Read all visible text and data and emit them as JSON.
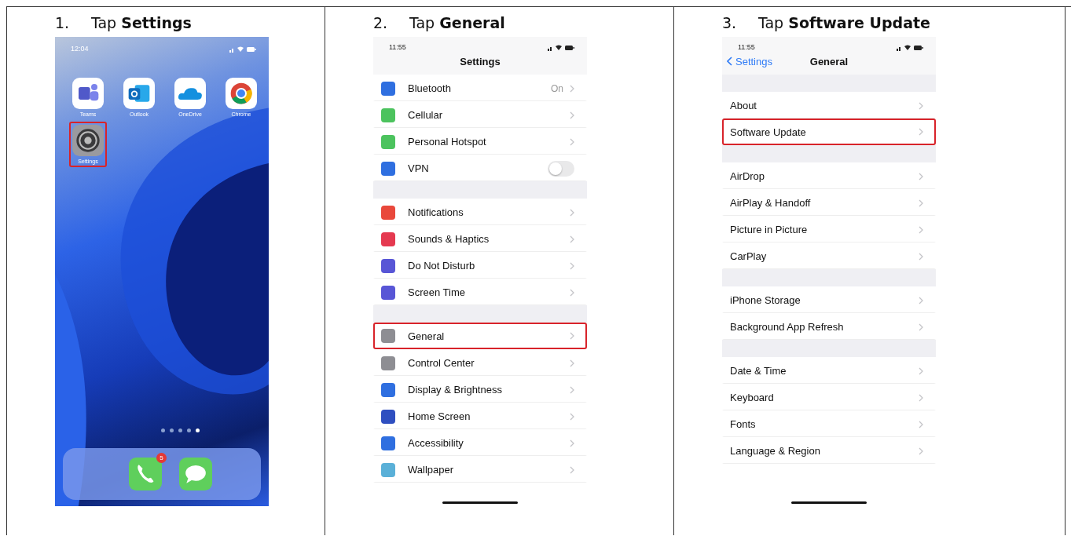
{
  "steps": [
    {
      "number": "1.",
      "instruction": "Tap **Settings**",
      "screen": {
        "kind": "home",
        "status_time": "12:04",
        "apps": [
          {
            "label": "Teams",
            "kind": "people",
            "highlighted": false
          },
          {
            "label": "Outlook",
            "kind": "envelope",
            "highlighted": false
          },
          {
            "label": "OneDrive",
            "kind": "cloud",
            "highlighted": false
          },
          {
            "label": "Chrome",
            "kind": "ring",
            "highlighted": false
          },
          {
            "label": "Settings",
            "kind": "gear",
            "highlighted": true
          }
        ],
        "page_dots": [
          {
            "selected": false
          },
          {
            "selected": false
          },
          {
            "selected": false
          },
          {
            "selected": false
          },
          {
            "selected": true
          }
        ],
        "dock": [
          {
            "kind": "phone",
            "badge": "5"
          },
          {
            "kind": "bubble"
          }
        ]
      }
    },
    {
      "number": "2.",
      "instruction": "Tap **General**",
      "screen": {
        "kind": "settings_list",
        "status_time": "11:55",
        "title": "Settings",
        "groups": [
          {
            "rows": [
              {
                "label": "Bluetooth",
                "color": "#2f6fe0",
                "kind": "link",
                "value": "On",
                "highlighted": false
              },
              {
                "label": "Cellular",
                "color": "#4cc35e",
                "kind": "link",
                "highlighted": false
              },
              {
                "label": "Personal Hotspot",
                "color": "#4cc35e",
                "kind": "link",
                "highlighted": false
              },
              {
                "label": "VPN",
                "color": "#2f6fe0",
                "kind": "toggle",
                "on": false,
                "highlighted": false
              }
            ]
          },
          {
            "rows": [
              {
                "label": "Notifications",
                "color": "#e9483b",
                "kind": "link",
                "highlighted": false
              },
              {
                "label": "Sounds & Haptics",
                "color": "#e53950",
                "kind": "link",
                "highlighted": false
              },
              {
                "label": "Do Not Disturb",
                "color": "#5856d6",
                "kind": "link",
                "highlighted": false
              },
              {
                "label": "Screen Time",
                "color": "#5856d6",
                "kind": "link",
                "highlighted": false
              }
            ]
          },
          {
            "rows": [
              {
                "label": "General",
                "color": "#8e8e93",
                "kind": "link",
                "highlighted": true
              },
              {
                "label": "Control Center",
                "color": "#8e8e93",
                "kind": "link",
                "highlighted": false
              },
              {
                "label": "Display & Brightness",
                "color": "#2f6fe0",
                "kind": "link",
                "highlighted": false
              },
              {
                "label": "Home Screen",
                "color": "#2f4fc0",
                "kind": "link",
                "highlighted": false
              },
              {
                "label": "Accessibility",
                "color": "#2f6fe0",
                "kind": "link",
                "highlighted": false
              },
              {
                "label": "Wallpaper",
                "color": "#5ab0d8",
                "kind": "link",
                "highlighted": false
              }
            ]
          }
        ]
      }
    },
    {
      "number": "3.",
      "instruction": "Tap **Software Update**",
      "screen": {
        "kind": "settings_list",
        "status_time": "11:55",
        "back": "Settings",
        "title": "General",
        "top_gap": true,
        "groups": [
          {
            "rows": [
              {
                "label": "About",
                "kind": "link",
                "highlighted": false
              },
              {
                "label": "Software Update",
                "kind": "link",
                "highlighted": true
              }
            ]
          },
          {
            "rows": [
              {
                "label": "AirDrop",
                "kind": "link",
                "highlighted": false
              },
              {
                "label": "AirPlay & Handoff",
                "kind": "link",
                "highlighted": false
              },
              {
                "label": "Picture in Picture",
                "kind": "link",
                "highlighted": false
              },
              {
                "label": "CarPlay",
                "kind": "link",
                "highlighted": false
              }
            ]
          },
          {
            "rows": [
              {
                "label": "iPhone Storage",
                "kind": "link",
                "highlighted": false
              },
              {
                "label": "Background App Refresh",
                "kind": "link",
                "highlighted": false
              }
            ]
          },
          {
            "rows": [
              {
                "label": "Date & Time",
                "kind": "link",
                "highlighted": false
              },
              {
                "label": "Keyboard",
                "kind": "link",
                "highlighted": false
              },
              {
                "label": "Fonts",
                "kind": "link",
                "highlighted": false
              },
              {
                "label": "Language & Region",
                "kind": "link",
                "highlighted": false
              }
            ]
          }
        ]
      }
    }
  ]
}
